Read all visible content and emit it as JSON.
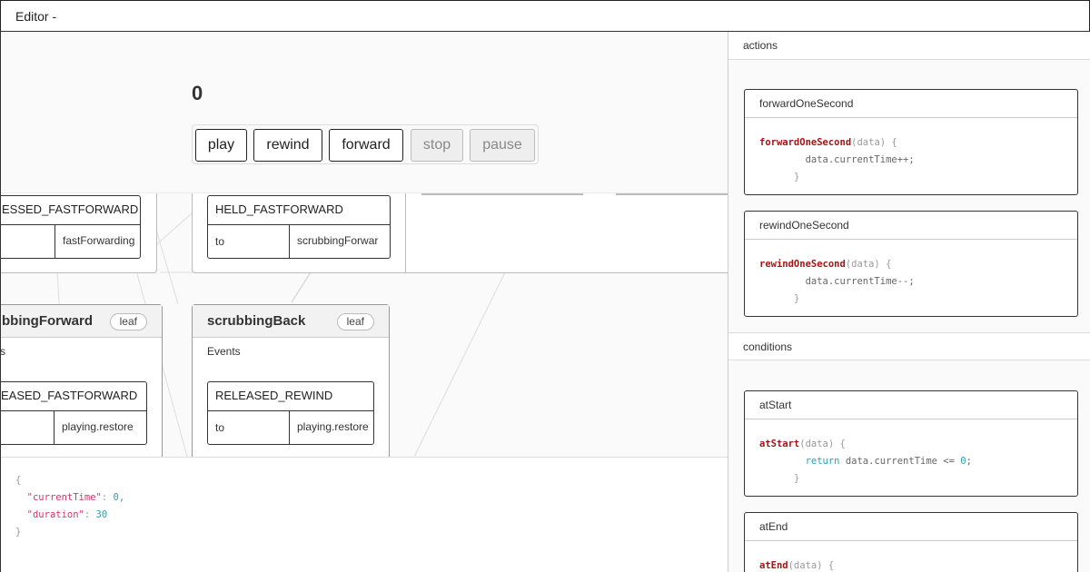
{
  "window": {
    "title": "Editor -"
  },
  "player": {
    "counter": "0",
    "buttons": {
      "play": "play",
      "rewind": "rewind",
      "forward": "forward",
      "stop": "stop",
      "pause": "pause"
    }
  },
  "diagram": {
    "event_fast": {
      "name": "ESSED_FASTFORWARD",
      "target": "fastForwarding"
    },
    "event_held": {
      "name": "HELD_FASTFORWARD",
      "to": "to",
      "target": "scrubbingForwar"
    },
    "state_forward": {
      "name": "bbingForward",
      "leaf": "leaf",
      "events_label": "s",
      "event": {
        "name": "EASED_FASTFORWARD",
        "target": "playing.restore"
      }
    },
    "state_back": {
      "name": "scrubbingBack",
      "leaf": "leaf",
      "events_label": "Events",
      "event": {
        "name": "RELEASED_REWIND",
        "to": "to",
        "target": "playing.restore"
      }
    }
  },
  "json_view": {
    "open": "{",
    "close": "}",
    "fields": [
      {
        "key": "\"currentTime\"",
        "value": "0,"
      },
      {
        "key": "\"duration\"",
        "value": "30"
      }
    ]
  },
  "sidebar": {
    "actions_label": "actions",
    "conditions_label": "conditions",
    "actions": [
      {
        "name": "forwardOneSecond",
        "fn": "forwardOneSecond",
        "sig": "(data) {",
        "body": "data.currentTime++;",
        "end": "}"
      },
      {
        "name": "rewindOneSecond",
        "fn": "rewindOneSecond",
        "sig": "(data) {",
        "body": "data.currentTime--;",
        "end": "}"
      }
    ],
    "conditions": [
      {
        "name": "atStart",
        "fn": "atStart",
        "sig": "(data) {",
        "ret": "return",
        "body": "data.currentTime <=",
        "num": "0",
        "semi": ";",
        "end": "}"
      },
      {
        "name": "atEnd",
        "fn": "atEnd",
        "sig": "(data) {"
      }
    ]
  }
}
